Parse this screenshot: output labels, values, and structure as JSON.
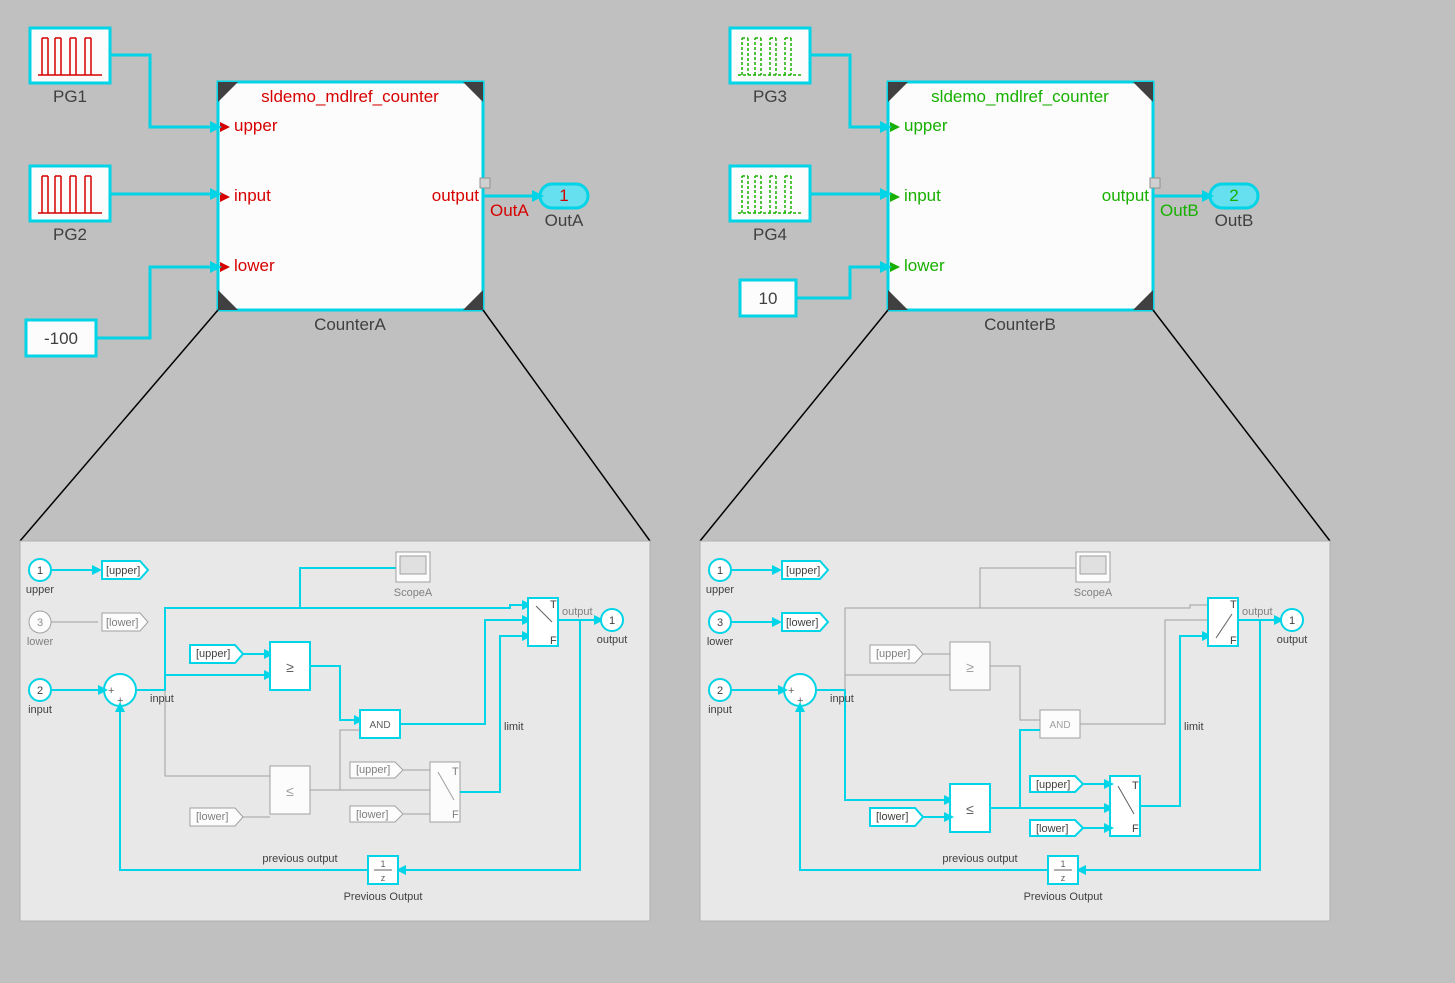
{
  "left": {
    "modelRefTitle": "sldemo_mdlref_counter",
    "modelRefName": "CounterA",
    "ports": {
      "upper": "upper",
      "input": "input",
      "lower": "lower",
      "output": "output"
    },
    "pg1": {
      "name": "PG1"
    },
    "pg2": {
      "name": "PG2"
    },
    "constValue": "-100",
    "outSignal": "OutA",
    "outName": "OutA",
    "outIndex": "1"
  },
  "right": {
    "modelRefTitle": "sldemo_mdlref_counter",
    "modelRefName": "CounterB",
    "ports": {
      "upper": "upper",
      "input": "input",
      "lower": "lower",
      "output": "output"
    },
    "pg3": {
      "name": "PG3"
    },
    "pg4": {
      "name": "PG4"
    },
    "constValue": "10",
    "outSignal": "OutB",
    "outName": "OutB",
    "outIndex": "2"
  },
  "sub": {
    "inUpper": {
      "idx": "1",
      "name": "upper"
    },
    "inInput": {
      "idx": "2",
      "name": "input"
    },
    "inLower": {
      "idx": "3",
      "name": "lower"
    },
    "out": {
      "idx": "1",
      "name": "output"
    },
    "gotoUpper": "[upper]",
    "gotoLower": "[lower]",
    "scope": "ScopeA",
    "and": "AND",
    "geq": "≥",
    "leq": "≤",
    "switchT": "T",
    "switchF": "F",
    "prevOut": "Previous Output",
    "prevSig": "previous output",
    "delayNum": "1",
    "delayDen": "z",
    "inputSig": "input",
    "limitSig": "limit",
    "outSig": "output"
  }
}
